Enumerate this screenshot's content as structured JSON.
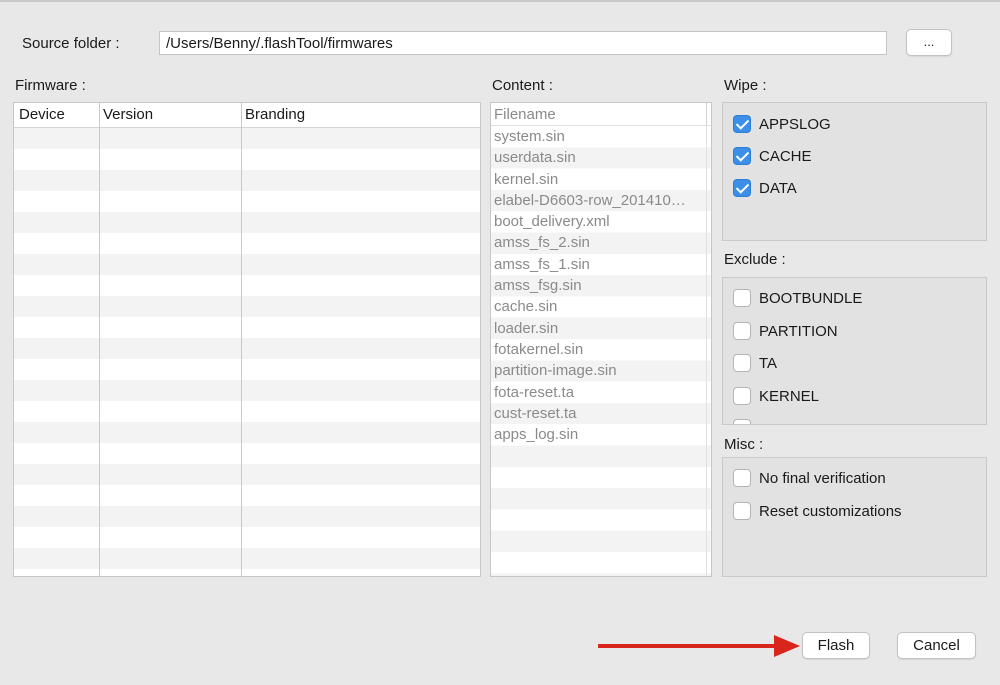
{
  "source": {
    "label": "Source folder :",
    "path": "/Users/Benny/.flashTool/firmwares",
    "browse_label": "..."
  },
  "firmware": {
    "label": "Firmware :",
    "columns": [
      "Device",
      "Version",
      "Branding"
    ]
  },
  "content": {
    "label": "Content :",
    "header": "Filename",
    "files": [
      "system.sin",
      "userdata.sin",
      "kernel.sin",
      "elabel-D6603-row_201410…",
      "boot_delivery.xml",
      "amss_fs_2.sin",
      "amss_fs_1.sin",
      "amss_fsg.sin",
      "cache.sin",
      "loader.sin",
      "fotakernel.sin",
      "partition-image.sin",
      "fota-reset.ta",
      "cust-reset.ta",
      "apps_log.sin"
    ]
  },
  "wipe": {
    "label": "Wipe :",
    "items": [
      {
        "label": "APPSLOG",
        "checked": true
      },
      {
        "label": "CACHE",
        "checked": true
      },
      {
        "label": "DATA",
        "checked": true
      }
    ]
  },
  "exclude": {
    "label": "Exclude :",
    "items": [
      {
        "label": "BOOTBUNDLE",
        "checked": false
      },
      {
        "label": "PARTITION",
        "checked": false
      },
      {
        "label": "TA",
        "checked": false
      },
      {
        "label": "KERNEL",
        "checked": false
      }
    ]
  },
  "misc": {
    "label": "Misc :",
    "items": [
      {
        "label": "No final verification",
        "checked": false
      },
      {
        "label": "Reset customizations",
        "checked": false
      }
    ]
  },
  "buttons": {
    "flash": "Flash",
    "cancel": "Cancel"
  },
  "colors": {
    "accent": "#3b8fe8",
    "arrow": "#d9261c"
  },
  "icons": {
    "annotation_arrow": "red-arrow-icon"
  }
}
